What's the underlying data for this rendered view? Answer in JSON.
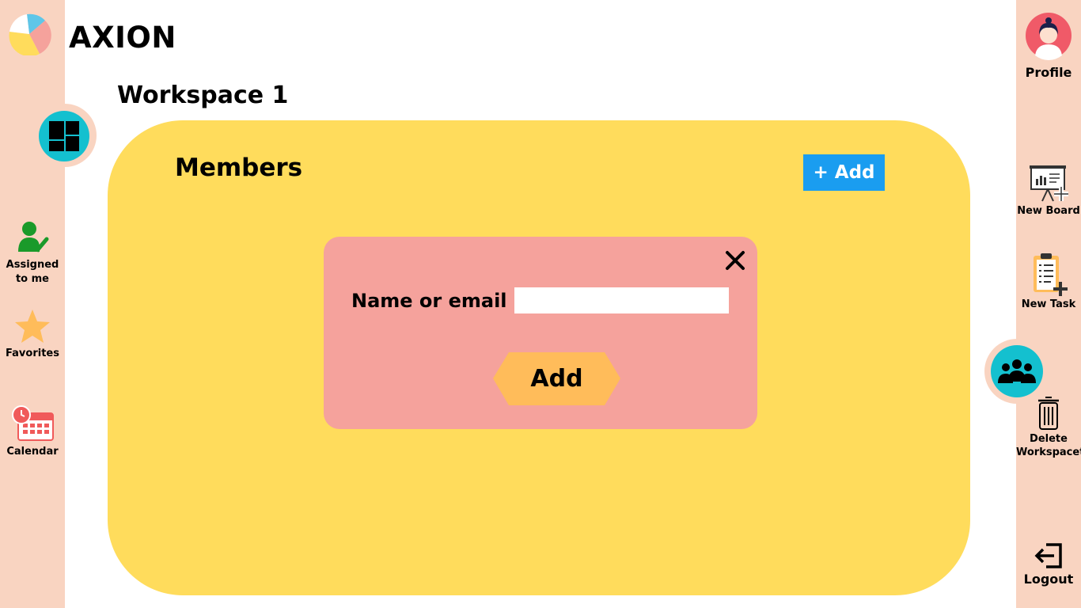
{
  "app": {
    "brand": "AXION"
  },
  "page": {
    "title": "Workspace 1"
  },
  "left_nav": {
    "workspace_button": {
      "icon": "board-layout-icon"
    },
    "items": [
      {
        "label_line1": "Assigned",
        "label_line2": "to me",
        "icon": "user-check-icon"
      },
      {
        "label": "Favorites",
        "icon": "star-icon"
      },
      {
        "label": "Calendar",
        "icon": "calendar-icon"
      }
    ]
  },
  "panel": {
    "title": "Members",
    "add_button_label": "+ Add"
  },
  "modal": {
    "field_label": "Name or email",
    "field_value": "",
    "field_placeholder": "",
    "submit_label": "Add",
    "close_icon": "close-icon"
  },
  "right_nav": {
    "profile_label": "Profile",
    "new_board_label": "New Board",
    "new_task_label": "New Task",
    "delete_label_line1": "Delete",
    "delete_label_line2": "Workspacet",
    "logout_label": "Logout"
  },
  "colors": {
    "rail": "#f9d4c1",
    "panel": "#ffdc5c",
    "modal": "#f5a29c",
    "accent_blue": "#1a9df0",
    "teal": "#14c0cf",
    "add_button": "#ffbc5a"
  }
}
